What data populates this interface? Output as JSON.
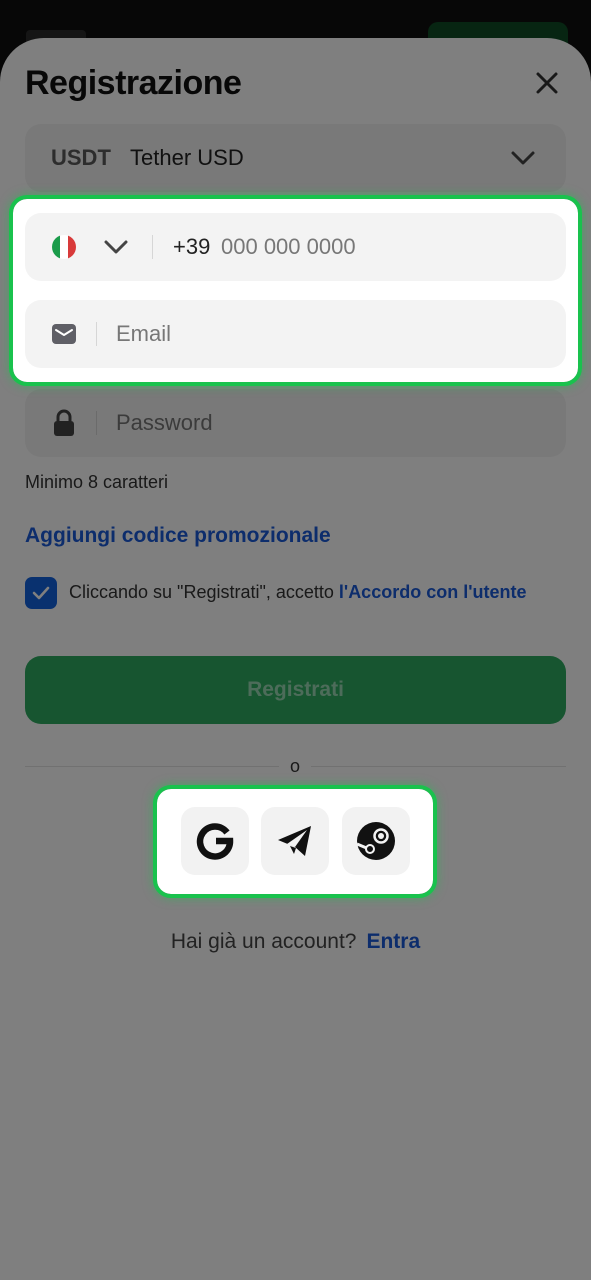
{
  "title": "Registrazione",
  "currency": {
    "code": "USDT",
    "name": "Tether USD"
  },
  "phone": {
    "prefix": "+39",
    "placeholder": "000 000 0000",
    "flag": "italy-flag"
  },
  "email": {
    "placeholder": "Email"
  },
  "password": {
    "placeholder": "Password",
    "hint": "Minimo 8 caratteri"
  },
  "promo_link": "Aggiungi codice promozionale",
  "terms": {
    "text": "Cliccando su \"Registrati\", accetto ",
    "link": "l'Accordo con l'utente",
    "checked": true
  },
  "register_button": "Registrati",
  "divider": "o",
  "social": [
    "google-icon",
    "telegram-icon",
    "steam-icon"
  ],
  "login": {
    "text": "Hai già un account?",
    "link": "Entra"
  },
  "colors": {
    "accent_blue": "#1a5ad8",
    "checkbox": "#1363df",
    "register": "#2faa61",
    "highlight": "#19c24d"
  }
}
